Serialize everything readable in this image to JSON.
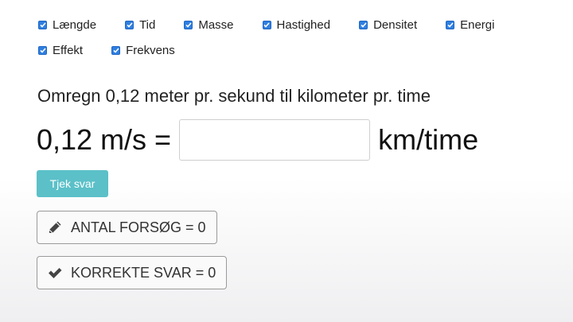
{
  "categories": [
    {
      "label": "Længde",
      "checked": true
    },
    {
      "label": "Tid",
      "checked": true
    },
    {
      "label": "Masse",
      "checked": true
    },
    {
      "label": "Hastighed",
      "checked": true
    },
    {
      "label": "Densitet",
      "checked": true
    },
    {
      "label": "Energi",
      "checked": true
    },
    {
      "label": "Effekt",
      "checked": true
    },
    {
      "label": "Frekvens",
      "checked": true
    }
  ],
  "question": "Omregn 0,12 meter pr. sekund til kilometer pr. time",
  "equation": {
    "left": "0,12 m/s =",
    "answer_value": "",
    "unit": "km/time"
  },
  "check_button_label": "Tjek svar",
  "stats": {
    "attempts_label": "ANTAL FORSØG = 0",
    "attempts_icon": "pencil-icon",
    "correct_label": "KORREKTE SVAR = 0",
    "correct_icon": "checkmark-icon"
  },
  "colors": {
    "checkbox": "#2f7fe0",
    "check_button": "#5bc0c8",
    "icon": "#444444"
  }
}
